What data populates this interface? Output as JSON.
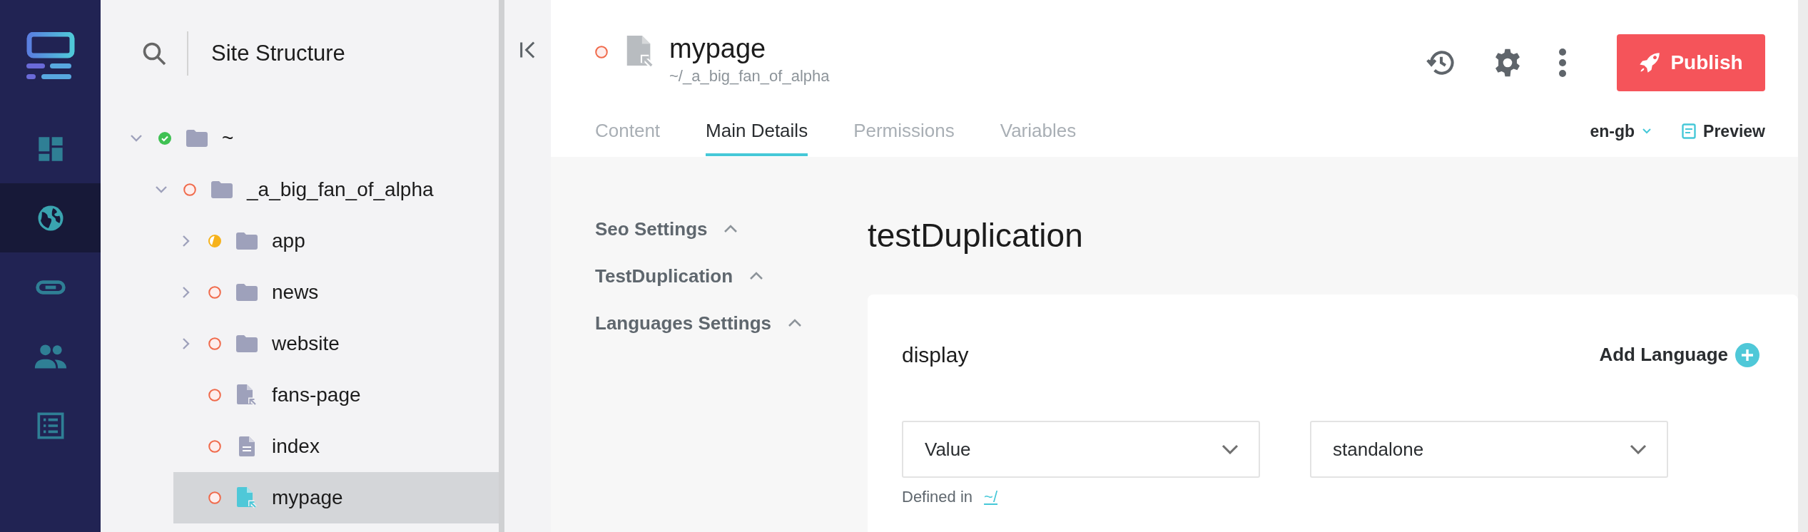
{
  "nav": [
    {
      "kind": "dashboard",
      "selected": false
    },
    {
      "kind": "globe",
      "selected": true
    },
    {
      "kind": "link",
      "selected": false
    },
    {
      "kind": "users",
      "selected": false
    },
    {
      "kind": "list",
      "selected": false
    }
  ],
  "sidebar": {
    "title": "Site Structure",
    "tree": [
      {
        "label": "~",
        "kind": "folder",
        "status": {
          "kind": "published"
        },
        "expanded": true,
        "selected": false,
        "children": [
          {
            "label": "_a_big_fan_of_alpha",
            "kind": "folder",
            "status": {
              "kind": "unpublished"
            },
            "expanded": true,
            "selected": false,
            "children": [
              {
                "label": "app",
                "kind": "folder",
                "status": {
                  "kind": "partial"
                },
                "expanded": false,
                "selected": false
              },
              {
                "label": "news",
                "kind": "folder",
                "status": {
                  "kind": "unpublished"
                },
                "expanded": false,
                "selected": false
              },
              {
                "label": "website",
                "kind": "folder",
                "status": {
                  "kind": "unpublished"
                },
                "expanded": false,
                "selected": false
              },
              {
                "label": "fans-page",
                "kind": "linked-page",
                "status": {
                  "kind": "unpublished"
                },
                "selected": false
              },
              {
                "label": "index",
                "kind": "page",
                "status": {
                  "kind": "unpublished"
                },
                "selected": false
              },
              {
                "label": "mypage",
                "kind": "linked-page",
                "status": {
                  "kind": "unpublished"
                },
                "selected": true
              }
            ]
          }
        ]
      }
    ]
  },
  "header": {
    "status": {
      "kind": "unpublished"
    },
    "title": "mypage",
    "path": "~/_a_big_fan_of_alpha",
    "publish": "Publish",
    "language": "en-gb",
    "preview": "Preview",
    "tabs": [
      {
        "label": "Content",
        "selected": false
      },
      {
        "label": "Main Details",
        "selected": true
      },
      {
        "label": "Permissions",
        "selected": false
      },
      {
        "label": "Variables",
        "selected": false
      }
    ]
  },
  "sections": [
    {
      "label": "Seo Settings",
      "expanded": true
    },
    {
      "label": "TestDuplication",
      "expanded": true
    },
    {
      "label": "Languages Settings",
      "expanded": true
    }
  ],
  "content": {
    "title": "testDuplication",
    "field": "display",
    "add_language": "Add Language",
    "selects": [
      {
        "value": "Value"
      },
      {
        "value": "standalone"
      }
    ],
    "defined_in": "Defined in",
    "defined_path": "~/"
  }
}
